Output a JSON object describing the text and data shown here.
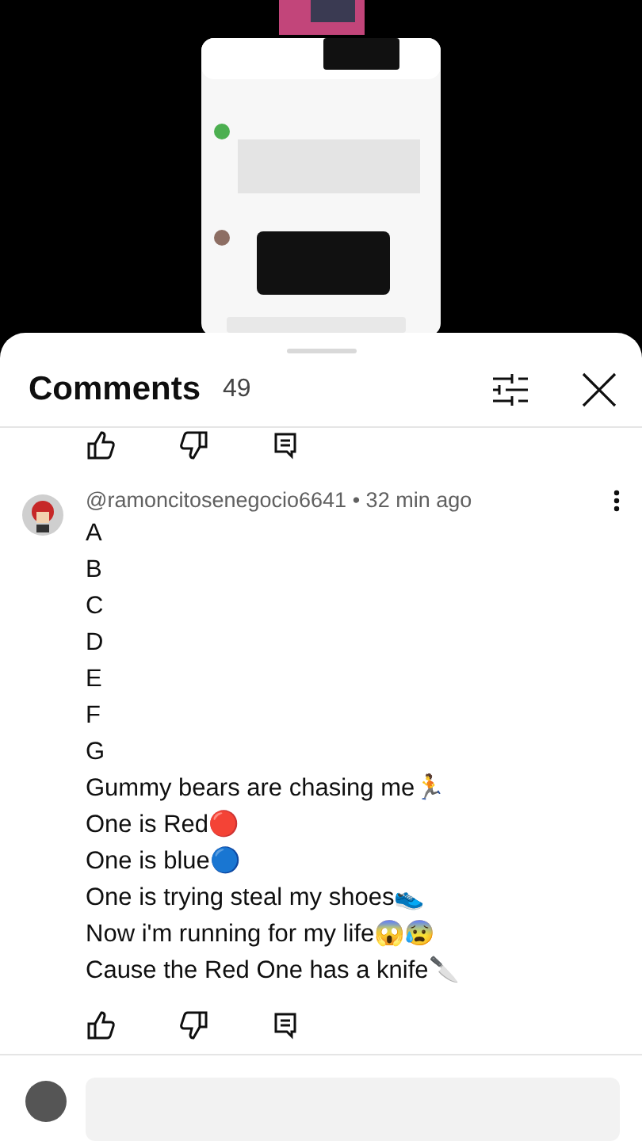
{
  "sheet": {
    "title": "Comments",
    "count": "49"
  },
  "comment": {
    "author": "@ramoncitosenegocio6641",
    "time": "• 32 min ago",
    "lines": [
      "A",
      "B",
      "C",
      "D",
      "E",
      "F",
      "G",
      "Gummy bears are chasing me🏃",
      "One is Red🔴",
      "One is blue🔵",
      "One is trying steal my shoes👟",
      "Now i'm running for my life😱😰",
      "Cause the Red One has a knife🔪"
    ]
  }
}
